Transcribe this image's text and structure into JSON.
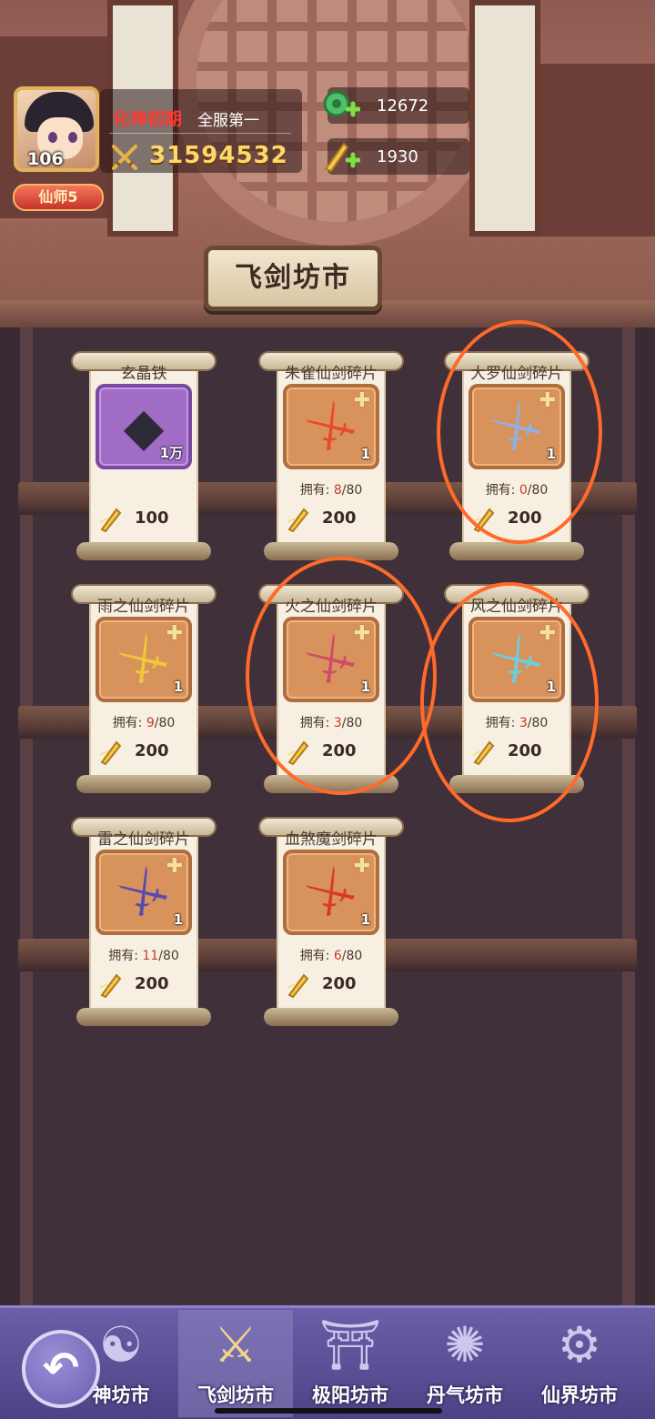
{
  "player": {
    "level": "106",
    "title_red": "化神初期",
    "title_white": "全服第一",
    "power": "31594532",
    "rank_badge": "仙师5"
  },
  "resources": [
    {
      "icon": "jade-coin-plus-icon",
      "value": "12672"
    },
    {
      "icon": "flying-sword-currency-plus-icon",
      "value": "1930"
    }
  ],
  "shop_title": "飞剑坊市",
  "items": [
    {
      "name": "玄晶铁",
      "icon": "dark-ore-icon",
      "qty": "1万",
      "owned": "",
      "owned_label": "",
      "price": "100"
    },
    {
      "name": "朱雀仙剑碎片",
      "icon": "vermilion-bird-sword-icon",
      "qty": "1",
      "owned_label": "拥有:",
      "owned": "8",
      "owned_max": "/80",
      "price": "200"
    },
    {
      "name": "大罗仙剑碎片",
      "icon": "daluo-sword-icon",
      "qty": "1",
      "owned_label": "拥有:",
      "owned": "0",
      "owned_max": "/80",
      "price": "200"
    },
    {
      "name": "雨之仙剑碎片",
      "icon": "rain-sword-icon",
      "qty": "1",
      "owned_label": "拥有:",
      "owned": "9",
      "owned_max": "/80",
      "price": "200"
    },
    {
      "name": "火之仙剑碎片",
      "icon": "fire-sword-icon",
      "qty": "1",
      "owned_label": "拥有:",
      "owned": "3",
      "owned_max": "/80",
      "price": "200"
    },
    {
      "name": "风之仙剑碎片",
      "icon": "wind-sword-icon",
      "qty": "1",
      "owned_label": "拥有:",
      "owned": "3",
      "owned_max": "/80",
      "price": "200"
    },
    {
      "name": "雷之仙剑碎片",
      "icon": "thunder-sword-icon",
      "qty": "1",
      "owned_label": "拥有:",
      "owned": "11",
      "owned_max": "/80",
      "price": "200"
    },
    {
      "name": "血煞魔剑碎片",
      "icon": "blood-demon-sword-icon",
      "qty": "1",
      "owned_label": "拥有:",
      "owned": "6",
      "owned_max": "/80",
      "price": "200"
    }
  ],
  "nav": {
    "tabs": [
      {
        "label": "神坊市",
        "icon": "taiji-shop-icon",
        "active": false
      },
      {
        "label": "飞剑坊市",
        "icon": "flying-sword-shop-icon",
        "active": true
      },
      {
        "label": "极阳坊市",
        "icon": "pavilion-shop-icon",
        "active": false
      },
      {
        "label": "丹气坊市",
        "icon": "flame-orb-shop-icon",
        "active": false
      },
      {
        "label": "仙界坊市",
        "icon": "gear-shop-icon",
        "active": false
      }
    ]
  },
  "colors": {
    "accent_gold": "#ffd86a",
    "owned_red": "#c83a2a",
    "annotation_orange": "#ff6a2a"
  }
}
